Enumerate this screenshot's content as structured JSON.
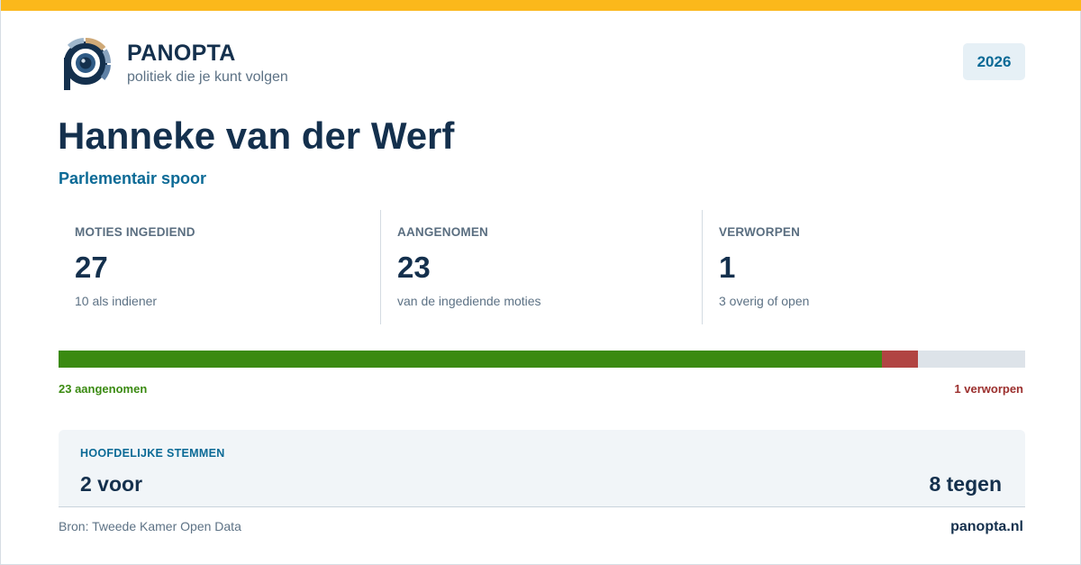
{
  "brand": {
    "name": "PANOPTA",
    "tagline": "politiek die je kunt volgen"
  },
  "year": "2026",
  "person": {
    "name": "Hanneke van der Werf",
    "track": "Parlementair spoor"
  },
  "stats": [
    {
      "label": "MOTIES INGEDIEND",
      "value": "27",
      "note": "10 als indiener"
    },
    {
      "label": "AANGENOMEN",
      "value": "23",
      "note": "van de ingediende moties"
    },
    {
      "label": "VERWORPEN",
      "value": "1",
      "note": "3 overig of open"
    }
  ],
  "progress": {
    "total": 27,
    "accepted": 23,
    "rejected": 1,
    "accepted_label": "23 aangenomen",
    "rejected_label": "1 verworpen"
  },
  "votes": {
    "label": "HOOFDELIJKE STEMMEN",
    "for_label": "2 voor",
    "against_label": "8 tegen"
  },
  "footer": {
    "source": "Bron: Tweede Kamer Open Data",
    "site": "panopta.nl"
  },
  "colors": {
    "accent_stripe": "#fbb81b",
    "navy": "#14304d",
    "blue": "#0b6a96",
    "accepted": "#3a8a11",
    "rejected": "#b14442"
  },
  "icons": {
    "logo": "panopta-eye-logo"
  }
}
